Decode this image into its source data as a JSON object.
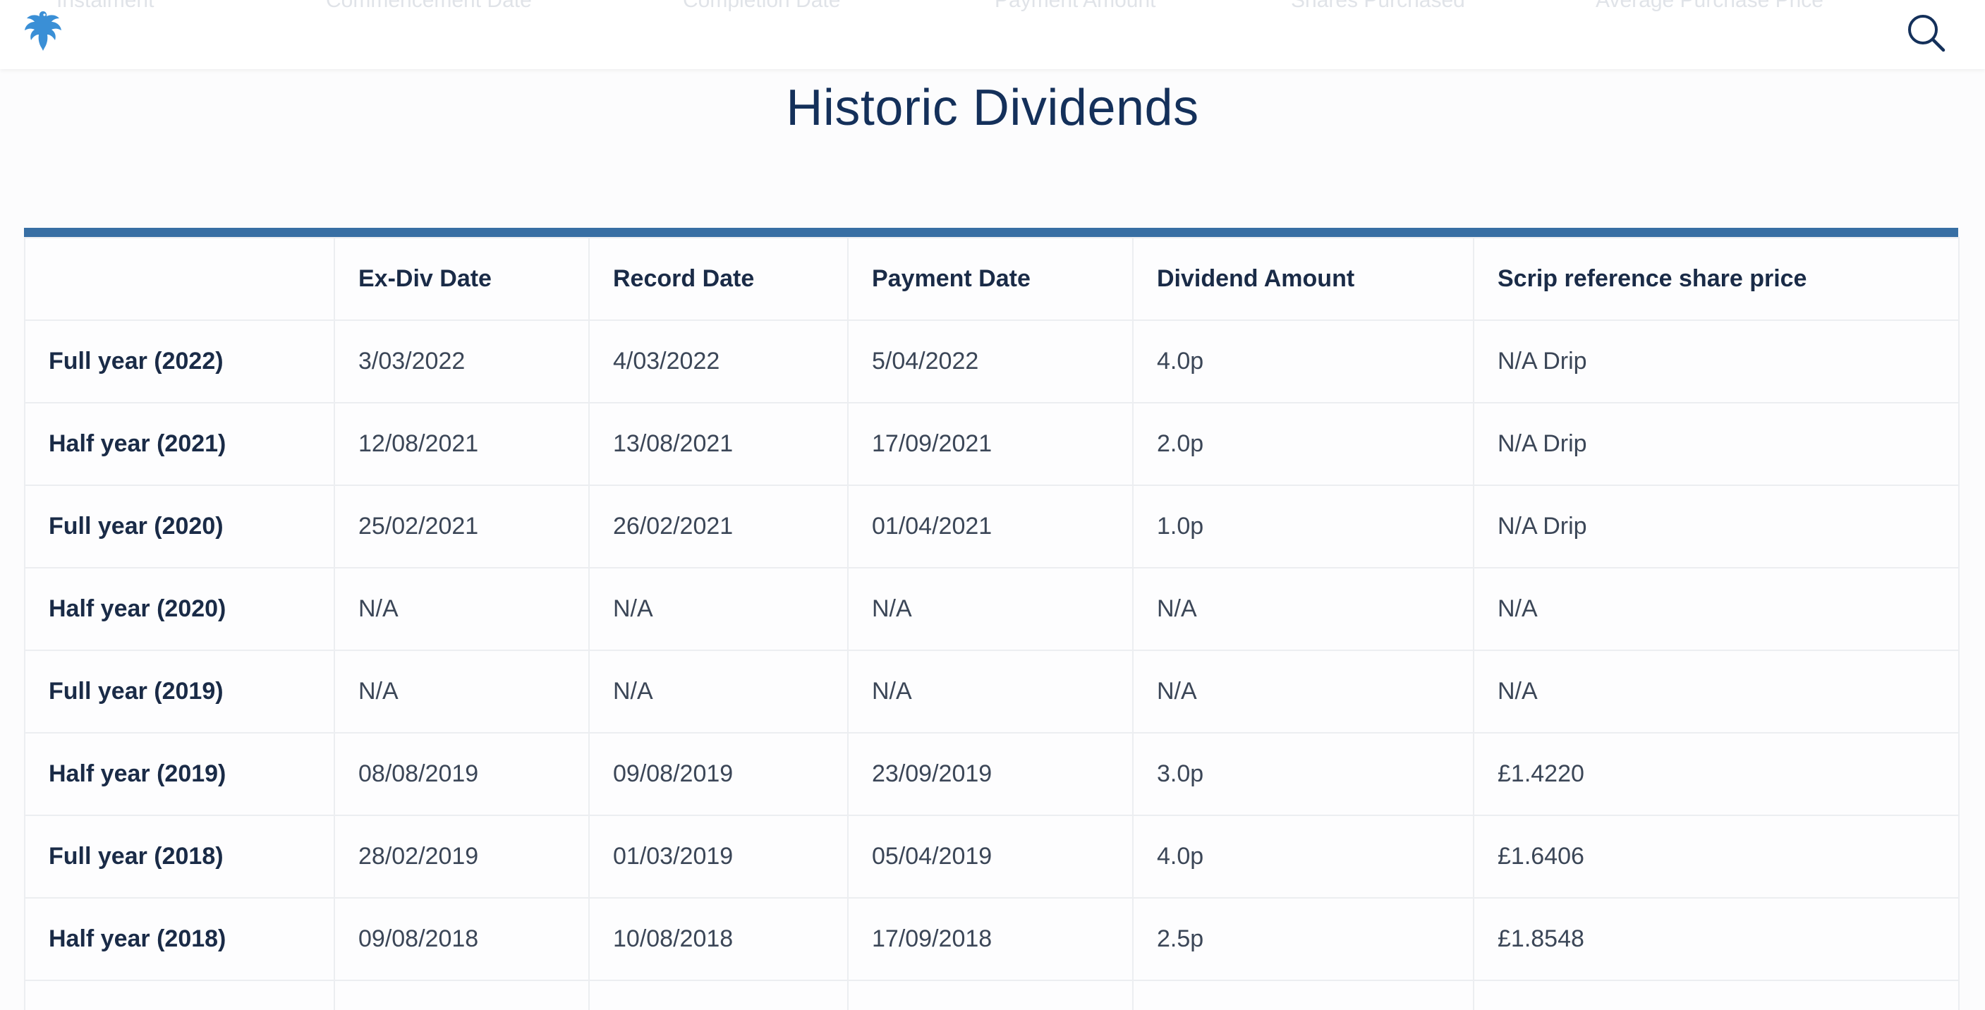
{
  "header": {
    "search_label": "Search",
    "ghost_columns": [
      "Instalment",
      "Commencement Date",
      "Completion Date",
      "Payment Amount",
      "Shares Purchased",
      "Average Purchase Price"
    ]
  },
  "page": {
    "title": "Historic Dividends"
  },
  "table": {
    "columns": [
      "",
      "Ex-Div Date",
      "Record Date",
      "Payment Date",
      "Dividend Amount",
      "Scrip reference share price"
    ],
    "rows": [
      {
        "period": "Full year (2022)",
        "ex_div": "3/03/2022",
        "record": "4/03/2022",
        "payment": "5/04/2022",
        "amount": "4.0p",
        "scrip": "N/A Drip"
      },
      {
        "period": "Half year (2021)",
        "ex_div": "12/08/2021",
        "record": "13/08/2021",
        "payment": "17/09/2021",
        "amount": "2.0p",
        "scrip": "N/A Drip"
      },
      {
        "period": "Full year (2020)",
        "ex_div": "25/02/2021",
        "record": "26/02/2021",
        "payment": "01/04/2021",
        "amount": "1.0p",
        "scrip": "N/A Drip"
      },
      {
        "period": "Half year (2020)",
        "ex_div": "N/A",
        "record": "N/A",
        "payment": "N/A",
        "amount": "N/A",
        "scrip": "N/A"
      },
      {
        "period": "Full year (2019)",
        "ex_div": "N/A",
        "record": "N/A",
        "payment": "N/A",
        "amount": "N/A",
        "scrip": "N/A"
      },
      {
        "period": "Half year (2019)",
        "ex_div": "08/08/2019",
        "record": "09/08/2019",
        "payment": "23/09/2019",
        "amount": "3.0p",
        "scrip": "£1.4220"
      },
      {
        "period": "Full year (2018)",
        "ex_div": "28/02/2019",
        "record": "01/03/2019",
        "payment": "05/04/2019",
        "amount": "4.0p",
        "scrip": "£1.6406"
      },
      {
        "period": "Half year (2018)",
        "ex_div": "09/08/2018",
        "record": "10/08/2018",
        "payment": "17/09/2018",
        "amount": "2.5p",
        "scrip": "£1.8548"
      }
    ]
  },
  "colors": {
    "accent": "#386fa4",
    "title": "#14305a",
    "logo": "#3a8fd6"
  }
}
